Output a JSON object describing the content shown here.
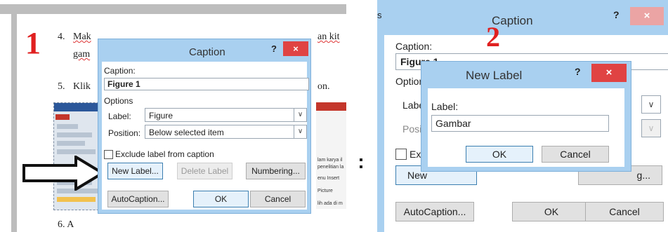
{
  "step_markers": {
    "left": "1",
    "right": "2"
  },
  "document": {
    "item4_num": "4.",
    "item4_line1_start": "Mak",
    "item4_line1_end": "an kit",
    "item4_line2": "gam",
    "item5_num": "5.",
    "item5_start": "Klik",
    "item5_end": "on.",
    "item6": "6.  A",
    "snippets": [
      "lam karya il",
      "penelitian la",
      "enu Insert",
      "Picture",
      "lih ada di m"
    ]
  },
  "caption_dialog": {
    "title": "Caption",
    "help": "?",
    "close": "×",
    "caption_label": "Caption:",
    "caption_value": "Figure 1",
    "options_label": "Options",
    "label_label": "Label:",
    "label_value": "Figure",
    "position_label": "Position:",
    "position_value": "Below selected item",
    "exclude_label": "Exclude label from caption",
    "new_label_btn": "New Label...",
    "delete_label_btn": "Delete Label",
    "numbering_btn": "Numbering...",
    "autocaption_btn": "AutoCaption...",
    "ok_btn": "OK",
    "cancel_btn": "Cancel"
  },
  "caption_dialog_bg": {
    "title": "Caption",
    "help": "?",
    "close": "×",
    "caption_label": "Caption:",
    "caption_value": "Figure 1",
    "options_partial": "Option",
    "label_partial": "Label",
    "position_partial": "Positi",
    "exclude_partial": "Exc",
    "new_partial": "New",
    "numbering_partial": "g...",
    "autocaption_btn": "AutoCaption...",
    "ok_btn": "OK",
    "cancel_btn": "Cancel"
  },
  "new_label_dialog": {
    "title": "New Label",
    "help": "?",
    "close": "×",
    "label_label": "Label:",
    "label_value": "Gambar",
    "ok_btn": "OK",
    "cancel_btn": "Cancel"
  },
  "colors": {
    "accent_red": "#e02020",
    "dialog_frame": "#a9d0f0",
    "close_red": "#e04343"
  }
}
